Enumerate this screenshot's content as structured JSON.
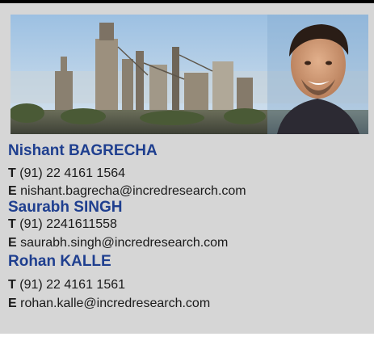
{
  "contacts": [
    {
      "name": "Nishant BAGRECHA",
      "phone_prefix": "T",
      "phone": "(91) 22 4161 1564",
      "email_prefix": "E",
      "email": "nishant.bagrecha@incredresearch.com"
    },
    {
      "name": "Saurabh SINGH",
      "phone_prefix": "T",
      "phone": "(91) 2241611558",
      "email_prefix": "E",
      "email": "saurabh.singh@incredresearch.com"
    },
    {
      "name": "Rohan KALLE",
      "phone_prefix": "T",
      "phone": "(91) 22 4161 1561",
      "email_prefix": "E",
      "email": "rohan.kalle@incredresearch.com"
    }
  ],
  "colors": {
    "name": "#1f3f8f",
    "panel": "#d6d6d6",
    "sky": "#a9c6e0"
  }
}
